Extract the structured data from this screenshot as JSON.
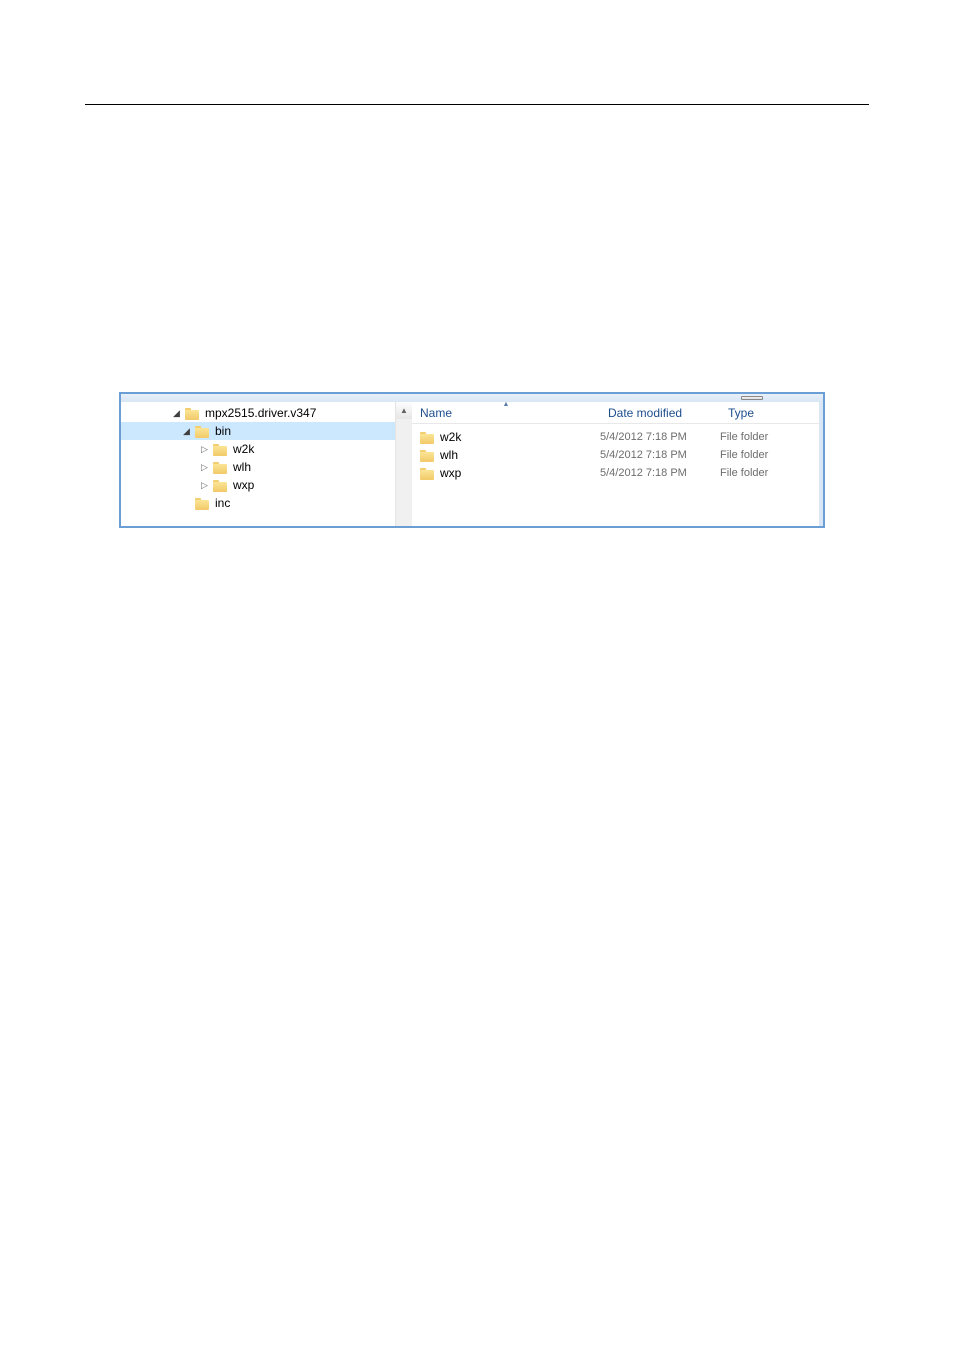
{
  "tree": {
    "items": [
      {
        "label": "mpx2515.driver.v347",
        "level": 0,
        "arrow": "expanded",
        "selected": false
      },
      {
        "label": "bin",
        "level": 1,
        "arrow": "expanded",
        "selected": true
      },
      {
        "label": "w2k",
        "level": 2,
        "arrow": "collapsed",
        "selected": false
      },
      {
        "label": "wlh",
        "level": 2,
        "arrow": "collapsed",
        "selected": false
      },
      {
        "label": "wxp",
        "level": 2,
        "arrow": "collapsed",
        "selected": false
      },
      {
        "label": "inc",
        "level": 1,
        "arrow": "none",
        "selected": false
      }
    ]
  },
  "columns": {
    "name": "Name",
    "date": "Date modified",
    "type": "Type"
  },
  "files": [
    {
      "name": "w2k",
      "date": "5/4/2012 7:18 PM",
      "type": "File folder"
    },
    {
      "name": "wlh",
      "date": "5/4/2012 7:18 PM",
      "type": "File folder"
    },
    {
      "name": "wxp",
      "date": "5/4/2012 7:18 PM",
      "type": "File folder"
    }
  ]
}
